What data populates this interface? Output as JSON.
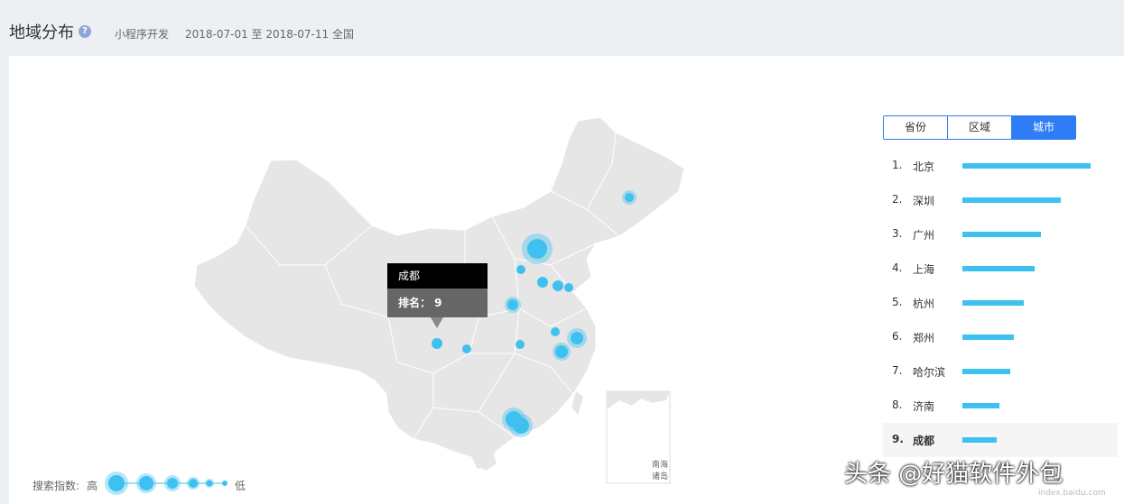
{
  "header": {
    "title": "地域分布",
    "help_glyph": "?",
    "keyword": "小程序开发",
    "date_range": "2018-07-01 至 2018-07-11",
    "region": "全国"
  },
  "map": {
    "inset_label_1": "南海",
    "inset_label_2": "诸岛"
  },
  "tooltip": {
    "city": "成都",
    "rank_text": "排名：  9"
  },
  "legend": {
    "label": "搜索指数:",
    "high": "高",
    "low": "低"
  },
  "tabs": [
    {
      "label": "省份",
      "active": false
    },
    {
      "label": "区域",
      "active": false
    },
    {
      "label": "城市",
      "active": true
    }
  ],
  "ranking": [
    {
      "rank": "1.",
      "city": "北京",
      "fraction": 1.0
    },
    {
      "rank": "2.",
      "city": "深圳",
      "fraction": 0.77
    },
    {
      "rank": "3.",
      "city": "广州",
      "fraction": 0.61
    },
    {
      "rank": "4.",
      "city": "上海",
      "fraction": 0.56
    },
    {
      "rank": "5.",
      "city": "杭州",
      "fraction": 0.48
    },
    {
      "rank": "6.",
      "city": "郑州",
      "fraction": 0.4
    },
    {
      "rank": "7.",
      "city": "哈尔滨",
      "fraction": 0.37
    },
    {
      "rank": "8.",
      "city": "济南",
      "fraction": 0.29
    },
    {
      "rank": "9.",
      "city": "成都",
      "fraction": 0.27
    }
  ],
  "colors": {
    "accent": "#2e7cf6",
    "bubble": "#3ec1ef",
    "map_fill": "#e6e6e6"
  },
  "watermark": "头条 @好猫软件外包",
  "watermark_url": "index.baidu.com"
}
